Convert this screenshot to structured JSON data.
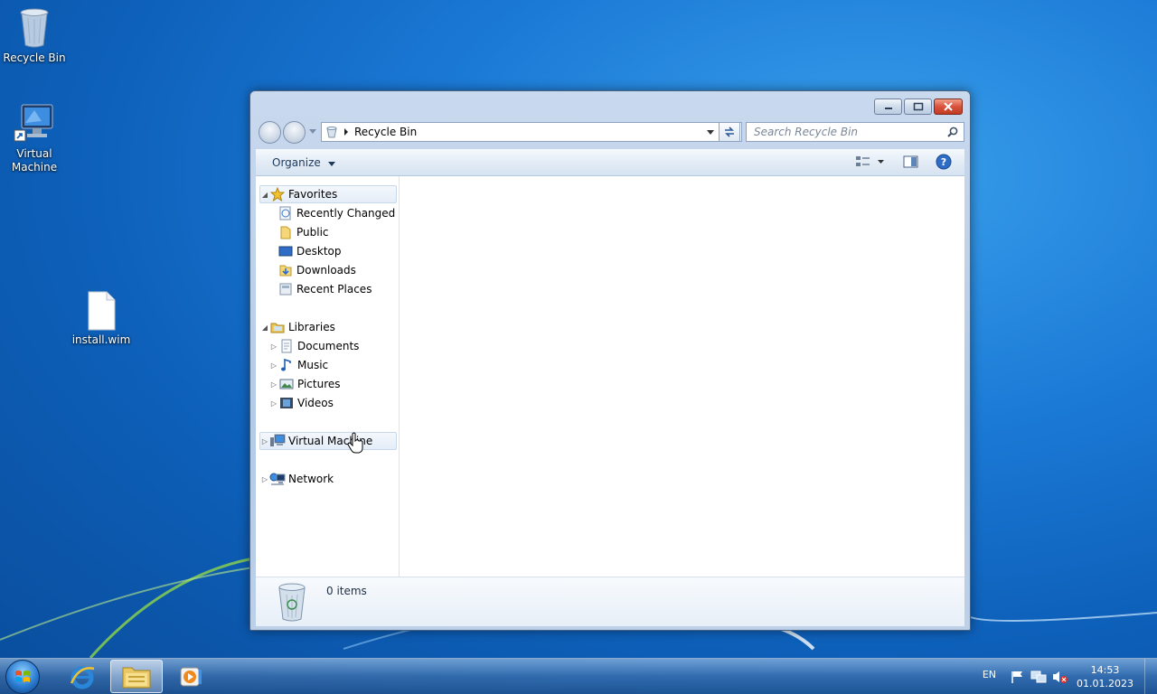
{
  "desktop": {
    "icons": [
      {
        "label": "Recycle Bin"
      },
      {
        "label": "Virtual\nMachine"
      },
      {
        "label": "install.wim"
      }
    ]
  },
  "window": {
    "address": {
      "breadcrumb": "Recycle Bin"
    },
    "search": {
      "placeholder": "Search Recycle Bin"
    },
    "toolbar": {
      "organize_label": "Organize"
    },
    "nav": {
      "favorites": {
        "label": "Favorites",
        "items": [
          "Recently Changed",
          "Public",
          "Desktop",
          "Downloads",
          "Recent Places"
        ]
      },
      "libraries": {
        "label": "Libraries",
        "items": [
          "Documents",
          "Music",
          "Pictures",
          "Videos"
        ]
      },
      "computer": {
        "label": "Virtual Machine"
      },
      "network": {
        "label": "Network"
      }
    },
    "status": {
      "items_text": "0 items"
    }
  },
  "taskbar": {
    "language": "EN",
    "time": "14:53",
    "date": "01.01.2023"
  },
  "colors": {
    "desktop_blue": "#1b7ad6",
    "close_red": "#d9523c",
    "link_blue": "#1e395b"
  }
}
